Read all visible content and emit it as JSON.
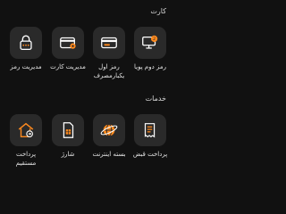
{
  "colors": {
    "accent": "#ff8a1e",
    "background": "#111111",
    "tile": "#2a2a2a"
  },
  "sections": {
    "cards": {
      "title": "کارت",
      "items": [
        {
          "line1": "رمز دوم پویا",
          "line2": "",
          "icon": "dynamic-password-icon"
        },
        {
          "line1": "رمز اول",
          "line2": "یکبارمصرف",
          "icon": "one-time-password-icon"
        },
        {
          "line1": "مدیریت کارت",
          "line2": "",
          "icon": "card-settings-icon"
        },
        {
          "line1": "مدیریت رمز",
          "line2": "",
          "icon": "password-lock-icon"
        }
      ]
    },
    "services": {
      "title": "خدمات",
      "items": [
        {
          "line1": "پرداخت قبض",
          "line2": "",
          "icon": "bill-payment-icon"
        },
        {
          "line1": "بسته اینترنت",
          "line2": "",
          "icon": "internet-globe-icon"
        },
        {
          "line1": "شارژ",
          "line2": "",
          "icon": "sim-card-icon"
        },
        {
          "line1": "پرداخت",
          "line2": "مستقیم",
          "icon": "direct-payment-icon"
        }
      ]
    }
  }
}
